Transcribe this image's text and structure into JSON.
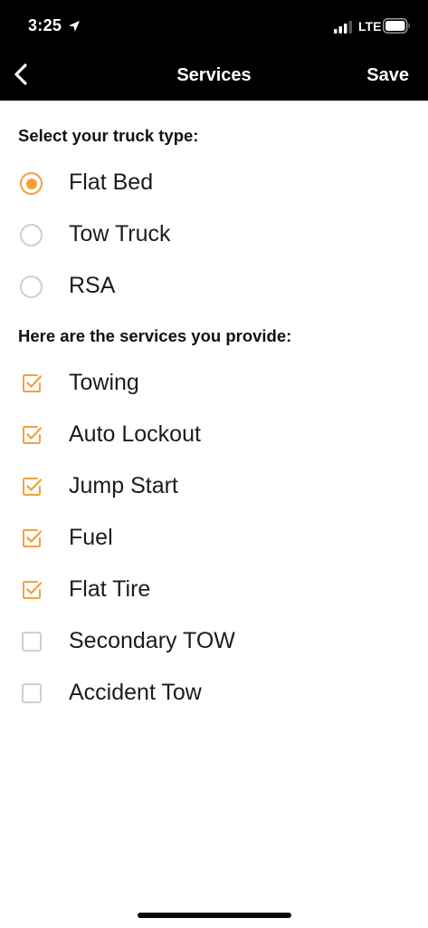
{
  "status_bar": {
    "time": "3:25",
    "network": "LTE",
    "icons": [
      "location-arrow-icon",
      "signal-icon",
      "battery-icon"
    ]
  },
  "nav": {
    "title": "Services",
    "save_label": "Save",
    "back_icon": "chevron-left-icon"
  },
  "truck_section": {
    "heading": "Select your truck type:",
    "options": [
      {
        "label": "Flat Bed",
        "selected": true
      },
      {
        "label": "Tow Truck",
        "selected": false
      },
      {
        "label": "RSA",
        "selected": false
      }
    ]
  },
  "services_section": {
    "heading": "Here are the services you provide:",
    "items": [
      {
        "label": "Towing",
        "checked": true
      },
      {
        "label": "Auto Lockout",
        "checked": true
      },
      {
        "label": "Jump Start",
        "checked": true
      },
      {
        "label": "Fuel",
        "checked": true
      },
      {
        "label": "Flat Tire",
        "checked": true
      },
      {
        "label": "Secondary TOW",
        "checked": false
      },
      {
        "label": "Accident Tow",
        "checked": false
      }
    ]
  },
  "colors": {
    "accent": "#f5a13a",
    "bar_background": "#000000",
    "unchecked_border": "#cfcfcf"
  }
}
